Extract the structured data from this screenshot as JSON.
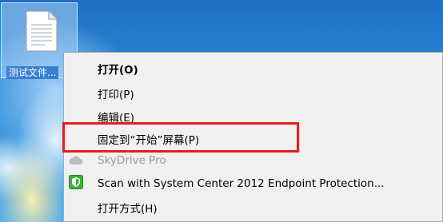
{
  "desktop": {
    "file_label": "测试文件..."
  },
  "context_menu": {
    "items": [
      {
        "label": "打开(O)"
      },
      {
        "label": "打印(P)"
      },
      {
        "label": "编辑(E)"
      },
      {
        "label": "固定到“开始”屏幕(P)"
      },
      {
        "label": "SkyDrive Pro"
      },
      {
        "label": "Scan with System Center 2012 Endpoint Protection..."
      },
      {
        "label": "打开方式(H)"
      }
    ]
  },
  "colors": {
    "highlight_box": "#e0201e",
    "menu_background": "#f0f0f0",
    "shield_green": "#3fae3a"
  },
  "icons": {
    "file": "document-icon",
    "skydrive": "cloud-icon",
    "scan": "shield-icon"
  }
}
